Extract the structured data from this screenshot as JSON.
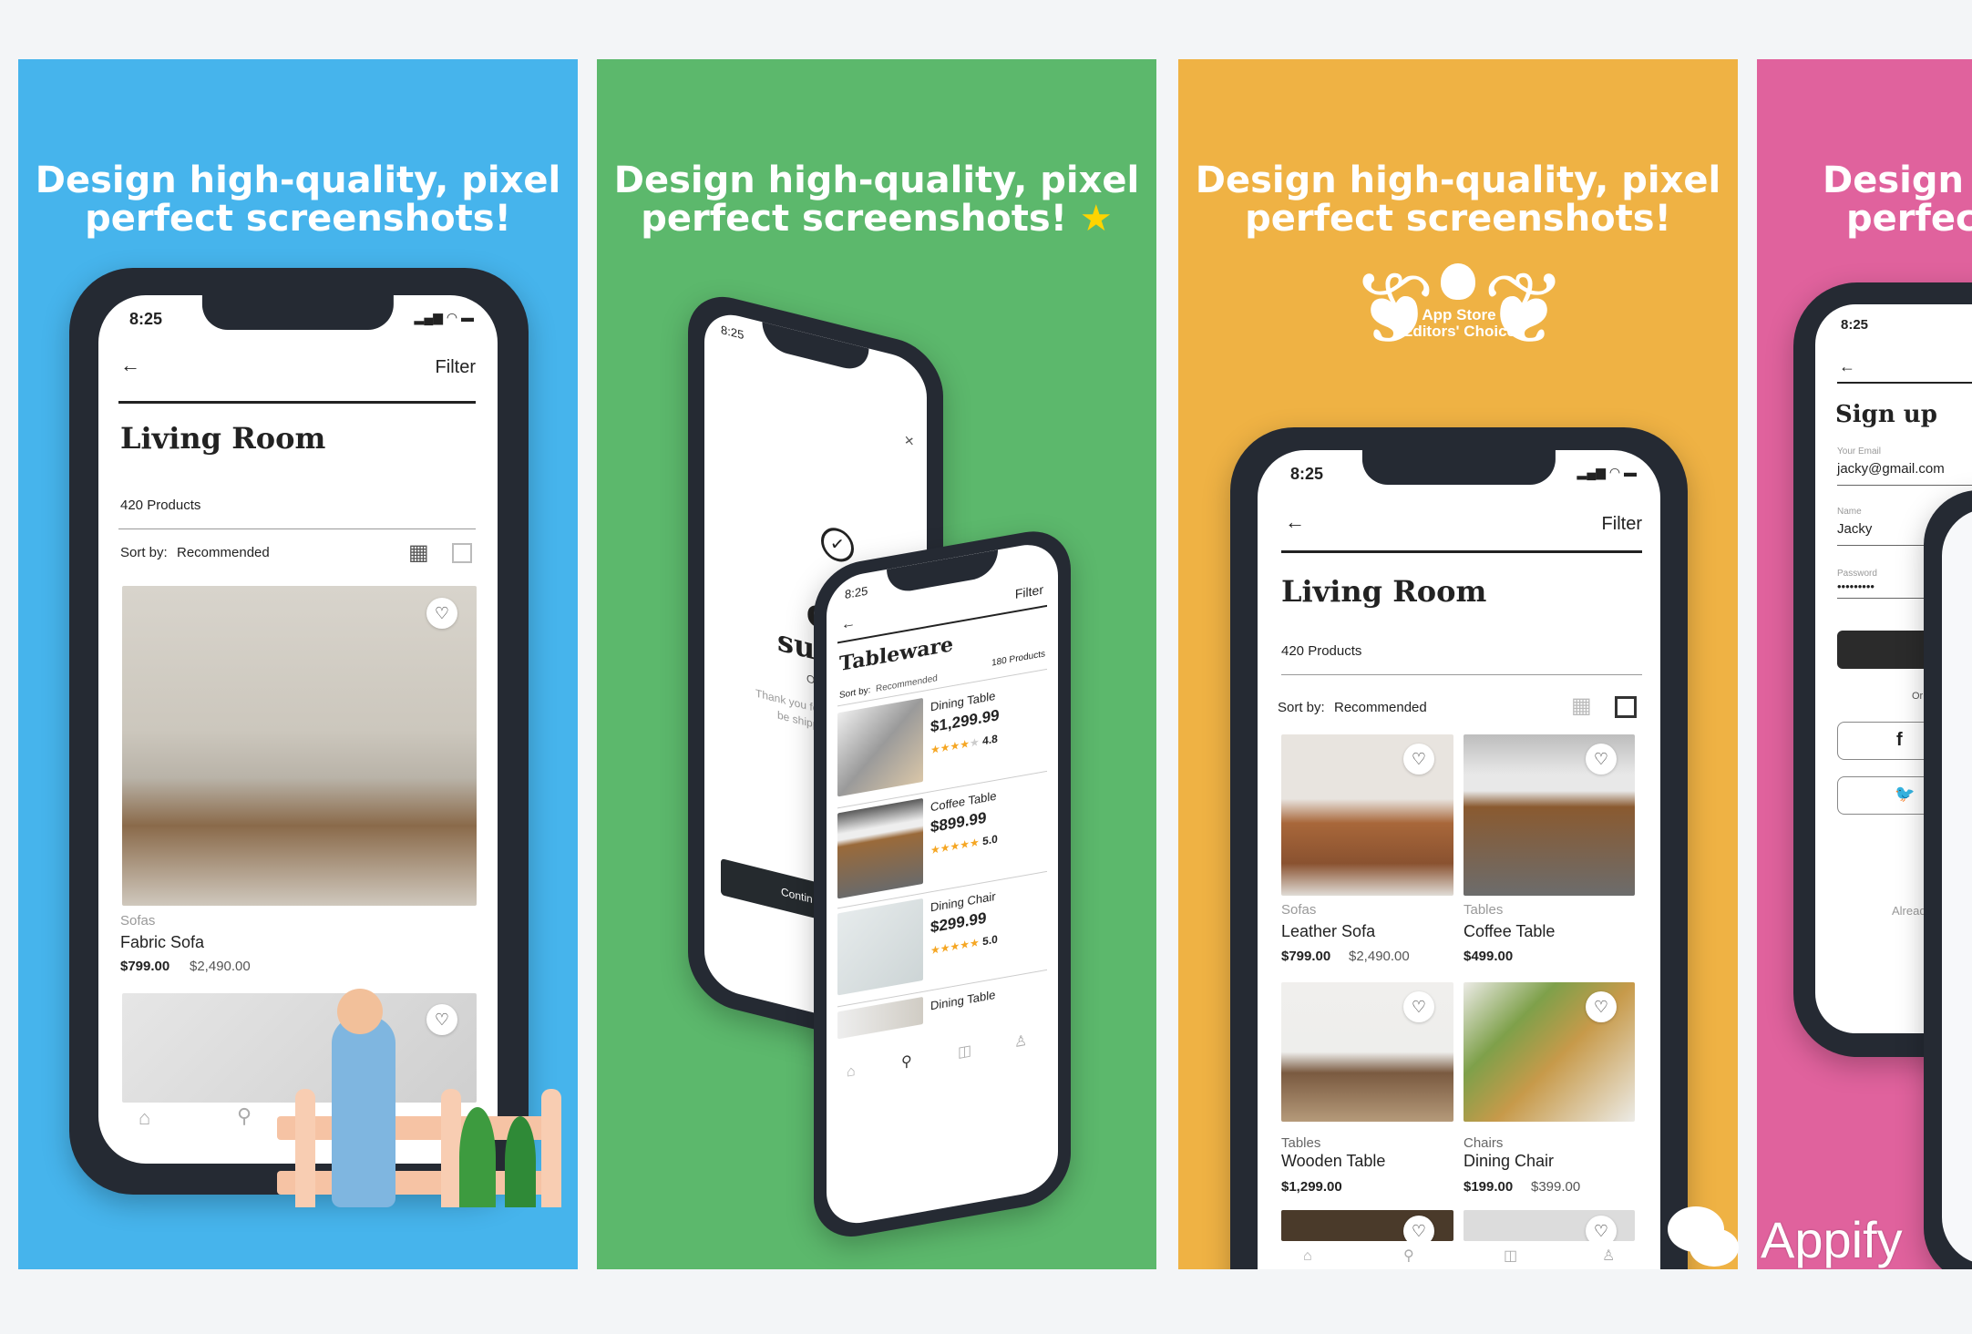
{
  "headline": {
    "line1": "Design high-quality, pixel",
    "line2": "perfect screenshots!",
    "pink_line1": "Design h",
    "pink_line2": "perfect"
  },
  "colors": {
    "blue": "#46b4ec",
    "green": "#5cb86c",
    "orange": "#efb244",
    "pink": "#e0629d",
    "star": "#f5a623"
  },
  "status_time": "8:25",
  "living_room": {
    "filter": "Filter",
    "title": "Living Room",
    "count": "420 Products",
    "sort_label": "Sort by:",
    "sort_value": "Recommended",
    "featured": {
      "category": "Sofas",
      "name": "Fabric Sofa",
      "price": "$799.00",
      "old_price": "$2,490.00"
    },
    "grid": [
      {
        "category": "Sofas",
        "name": "Leather Sofa",
        "price": "$799.00",
        "old_price": "$2,490.00"
      },
      {
        "category": "Tables",
        "name": "Coffee Table",
        "price": "$499.00",
        "old_price": ""
      },
      {
        "category": "Tables",
        "name": "Wooden Table",
        "price": "$1,299.00",
        "old_price": ""
      },
      {
        "category": "Chairs",
        "name": "Dining Chair",
        "price": "$199.00",
        "old_price": "$399.00"
      }
    ]
  },
  "order": {
    "title1": "Or",
    "title2": "succ",
    "sub": "Order",
    "msg1": "Thank you for pu",
    "msg2": "be shipped i",
    "button": "Contin"
  },
  "tableware": {
    "filter": "Filter",
    "title": "Tableware",
    "count": "180 Products",
    "sort_label": "Sort by:",
    "sort_value": "Recommended",
    "items": [
      {
        "name": "Dining Table",
        "price": "$1,299.99",
        "rating": "4.8",
        "stars": 4
      },
      {
        "name": "Coffee Table",
        "price": "$899.99",
        "rating": "5.0",
        "stars": 5
      },
      {
        "name": "Dining Chair",
        "price": "$299.99",
        "rating": "5.0",
        "stars": 5
      },
      {
        "name": "Dining Table",
        "price": "",
        "rating": "",
        "stars": 0
      }
    ]
  },
  "award": {
    "line1": "App Store",
    "line2": "Editors' Choice"
  },
  "signup": {
    "title": "Sign up",
    "email_label": "Your Email",
    "email": "jacky@gmail.com",
    "name_label": "Name",
    "name": "Jacky",
    "password_label": "Password",
    "password": "•••••••••",
    "or_text": "Or co",
    "already": "Alread"
  },
  "watermark": "Appify"
}
